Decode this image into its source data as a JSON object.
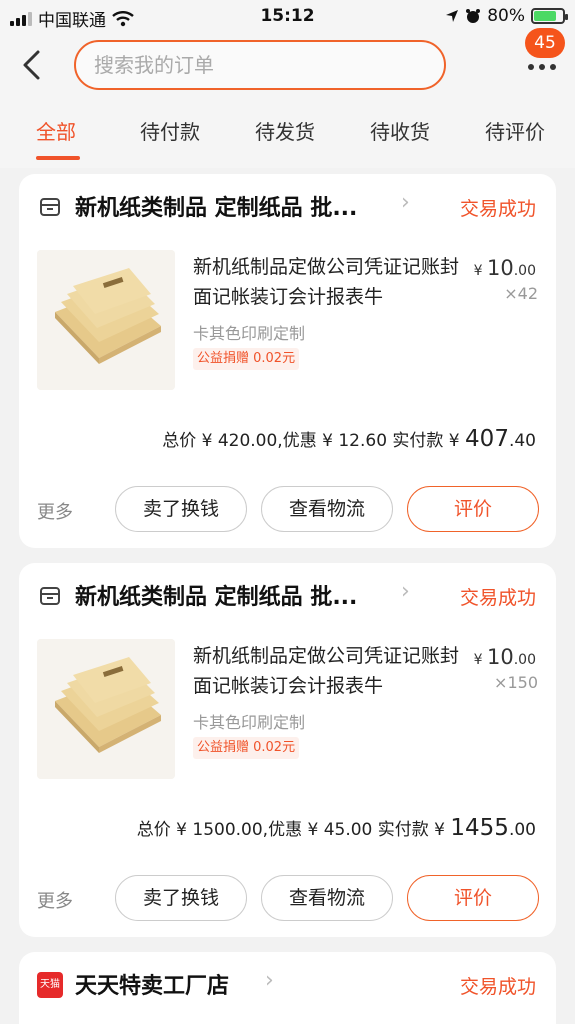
{
  "status_bar": {
    "carrier": "中国联通",
    "time": "15:12",
    "battery": "80%",
    "battery_level": 0.8
  },
  "header": {
    "search_placeholder": "搜索我的订单",
    "badge_count": "45"
  },
  "tabs": [
    {
      "label": "全部",
      "active": true
    },
    {
      "label": "待付款"
    },
    {
      "label": "待发货"
    },
    {
      "label": "待收货"
    },
    {
      "label": "待评价"
    }
  ],
  "orders": [
    {
      "shop_name": "新机纸类制品 定制纸品 批...",
      "status": "交易成功",
      "item_title": "新机纸制品定做公司凭证记账封面记帐装订会计报表牛",
      "price_symbol": "¥",
      "price_int": "10",
      "price_dec": ".00",
      "quantity": "×42",
      "spec": "卡其色印刷定制",
      "charity": "公益捐赠 0.02元",
      "summary_text": "总价 ¥ 420.00,优惠 ¥ 12.60  实付款 ¥",
      "pay_int": "407",
      "pay_dec": ".40",
      "more": "更多",
      "btn_sell": "卖了换钱",
      "btn_logistics": "查看物流",
      "btn_review": "评价"
    },
    {
      "shop_name": "新机纸类制品 定制纸品 批...",
      "status": "交易成功",
      "item_title": "新机纸制品定做公司凭证记账封面记帐装订会计报表牛",
      "price_symbol": "¥",
      "price_int": "10",
      "price_dec": ".00",
      "quantity": "×150",
      "spec": "卡其色印刷定制",
      "charity": "公益捐赠 0.02元",
      "summary_text": "总价 ¥ 1500.00,优惠 ¥ 45.00  实付款 ¥",
      "pay_int": "1455",
      "pay_dec": ".00",
      "more": "更多",
      "btn_sell": "卖了换钱",
      "btn_logistics": "查看物流",
      "btn_review": "评价"
    },
    {
      "shop_icon_text": "天猫",
      "shop_name": "天天特卖工厂店",
      "status": "交易成功"
    }
  ]
}
